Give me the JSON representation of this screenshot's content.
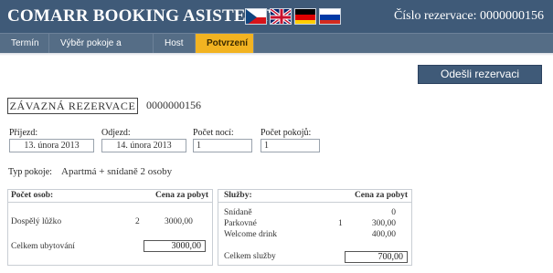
{
  "app": {
    "title": "COMARR BOOKING ASISTENT",
    "reservation_header": "Číslo rezervace: 0000000156",
    "languages": [
      "czech-flag-icon",
      "uk-flag-icon",
      "german-flag-icon",
      "russian-flag-icon"
    ]
  },
  "nav": {
    "tabs": [
      "Termín",
      "Výběr pokoje a služeb",
      "Host",
      "Potvrzení"
    ],
    "active_index": 3
  },
  "submit_label": "Odešli rezervaci",
  "binding": {
    "label": "ZÁVAZNÁ REZERVACE",
    "number": "0000000156"
  },
  "form": {
    "arrival_label": "Příjezd:",
    "arrival_value": "13. února 2013",
    "departure_label": "Odjezd:",
    "departure_value": "14. února 2013",
    "nights_label": "Počet nocí:",
    "nights_value": "1",
    "rooms_label": "Počet pokojů:",
    "rooms_value": "1",
    "room_type_label": "Typ pokoje:",
    "room_type_value": "Apartmá + snídaně 2 osoby"
  },
  "persons_table": {
    "header_left": "Počet osob:",
    "header_right": "Cena za pobyt",
    "rows": [
      {
        "name": "Dospělý lůžko",
        "count": "2",
        "price": "3000,00"
      }
    ],
    "total_label": "Celkem ubytování",
    "total_value": "3000,00"
  },
  "services_table": {
    "header_left": "Služby:",
    "header_right": "Cena za pobyt",
    "rows": [
      {
        "name": "Snídaně",
        "count": "",
        "price": "0"
      },
      {
        "name": "Parkovné",
        "count": "1",
        "price": "300,00"
      },
      {
        "name": "Welcome drink",
        "count": "",
        "price": "400,00"
      }
    ],
    "total_label": "Celkem služby",
    "total_value": "700,00"
  },
  "colors": {
    "header_bg": "#3f5a78",
    "nav_bg": "#556d86",
    "active_tab": "#f2b321"
  }
}
